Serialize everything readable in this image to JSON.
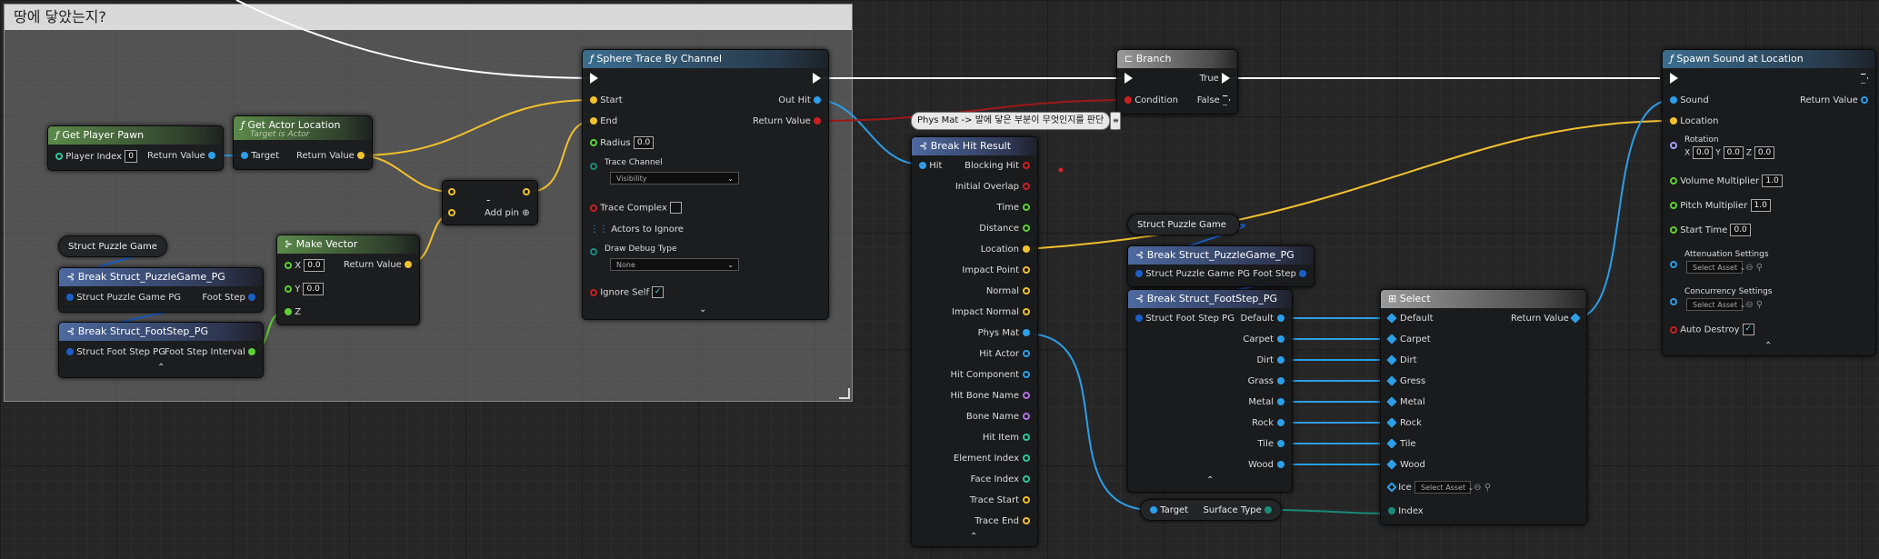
{
  "comment": {
    "title": "땅에 닿았는지?"
  },
  "get_player_pawn": {
    "title": "Get Player Pawn",
    "player_index_label": "Player Index",
    "player_index_value": "0",
    "return_label": "Return Value"
  },
  "get_actor_location": {
    "title": "Get Actor Location",
    "subtitle": "Target is Actor",
    "target_label": "Target",
    "return_label": "Return Value"
  },
  "subtract_node": {
    "symbol": "-",
    "add_pin_label": "Add pin"
  },
  "struct_puzzle_game_left": {
    "label": "Struct Puzzle Game"
  },
  "break_puzzle_left": {
    "title": "Break Struct_PuzzleGame_PG",
    "input_label": "Struct Puzzle Game PG",
    "output_label": "Foot Step"
  },
  "break_footstep_left": {
    "title": "Break Struct_FootStep_PG",
    "input_label": "Struct Foot Step PG",
    "output_label": "Foot Step Interval"
  },
  "make_vector": {
    "title": "Make Vector",
    "x_label": "X",
    "x_value": "0.0",
    "y_label": "Y",
    "y_value": "0.0",
    "z_label": "Z",
    "return_label": "Return Value"
  },
  "sphere_trace": {
    "title": "Sphere Trace By Channel",
    "start_label": "Start",
    "end_label": "End",
    "radius_label": "Radius",
    "radius_value": "0.0",
    "trace_channel_label": "Trace Channel",
    "trace_channel_value": "Visibility",
    "trace_complex_label": "Trace Complex",
    "actors_ignore_label": "Actors to Ignore",
    "debug_label": "Draw Debug Type",
    "debug_value": "None",
    "ignore_self_label": "Ignore Self",
    "out_hit_label": "Out Hit",
    "return_label": "Return Value"
  },
  "branch": {
    "title": "Branch",
    "condition_label": "Condition",
    "true_label": "True",
    "false_label": "False"
  },
  "tooltip": {
    "text": "Phys Mat -> 발에 닿은 부분이 무엇인지를 판단"
  },
  "break_hit_result": {
    "title": "Break Hit Result",
    "hit_label": "Hit",
    "outputs": [
      "Blocking Hit",
      "Initial Overlap",
      "Time",
      "Distance",
      "Location",
      "Impact Point",
      "Normal",
      "Impact Normal",
      "Phys Mat",
      "Hit Actor",
      "Hit Component",
      "Hit Bone Name",
      "Bone Name",
      "Hit Item",
      "Element Index",
      "Face Index",
      "Trace Start",
      "Trace End"
    ]
  },
  "struct_puzzle_game_mid": {
    "label": "Struct Puzzle Game"
  },
  "break_puzzle_mid": {
    "title": "Break Struct_PuzzleGame_PG",
    "input_label": "Struct Puzzle Game PG",
    "output_label": "Foot Step"
  },
  "break_footstep_mid": {
    "title": "Break Struct_FootStep_PG",
    "input_label": "Struct Foot Step PG",
    "outputs": [
      "Default",
      "Carpet",
      "Dirt",
      "Grass",
      "Metal",
      "Rock",
      "Tile",
      "Wood"
    ]
  },
  "surface_type": {
    "target_label": "Target",
    "output_label": "Surface Type"
  },
  "select_node": {
    "title": "Select",
    "return_label": "Return Value",
    "options": [
      "Default",
      "Carpet",
      "Dirt",
      "Gress",
      "Metal",
      "Rock",
      "Tile",
      "Wood"
    ],
    "ice_label": "Ice",
    "ice_value": "Select Asset",
    "index_label": "Index"
  },
  "spawn_sound": {
    "title": "Spawn Sound at Location",
    "sound_label": "Sound",
    "return_label": "Return Value",
    "location_label": "Location",
    "rotation_label": "Rotation",
    "rot_x_label": "X",
    "rot_x": "0.0",
    "rot_y_label": "Y",
    "rot_y": "0.0",
    "rot_z_label": "Z",
    "rot_z": "0.0",
    "volume_label": "Volume Multiplier",
    "volume_value": "1.0",
    "pitch_label": "Pitch Multiplier",
    "pitch_value": "1.0",
    "start_label": "Start Time",
    "start_value": "0.0",
    "attenuation_label": "Attenuation Settings",
    "attenuation_value": "Select Asset",
    "concurrency_label": "Concurrency Settings",
    "concurrency_value": "Select Asset",
    "auto_destroy_label": "Auto Destroy"
  },
  "colors": {
    "exec": "#ffffff",
    "object": "#2d9ee8",
    "vector": "#f2c12e",
    "float": "#5fd033",
    "bool": "#cc1e1e",
    "struct": "#1a5fc8"
  }
}
